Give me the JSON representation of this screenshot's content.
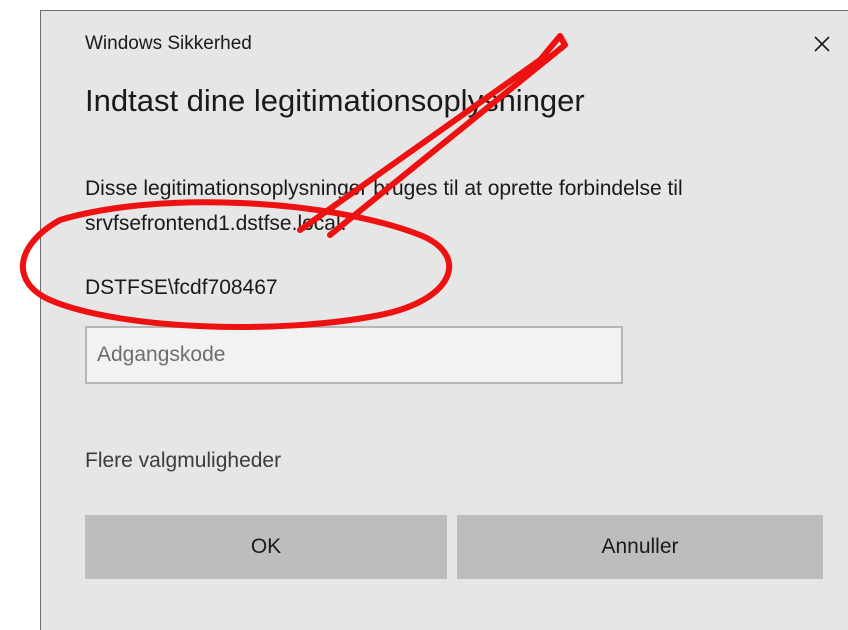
{
  "dialog": {
    "app_title": "Windows Sikkerhed",
    "heading": "Indtast dine legitimationsoplysninger",
    "description": "Disse legitimationsoplysninger bruges til at oprette forbindelse til srvfsefrontend1.dstfse.local.",
    "username": "DSTFSE\\fcdf708467",
    "password": {
      "value": "",
      "placeholder": "Adgangskode"
    },
    "more_options_label": "Flere valgmuligheder",
    "ok_label": "OK",
    "cancel_label": "Annuller",
    "close_icon": "close-icon"
  },
  "annotation": {
    "color": "#ee1111",
    "shapes": [
      "arrow",
      "ellipse"
    ]
  },
  "colors": {
    "dialog_background": "#e6e6e6",
    "button_background": "#bdbdbd",
    "input_background": "#f2f2f2",
    "input_border": "#b5b5b5"
  }
}
